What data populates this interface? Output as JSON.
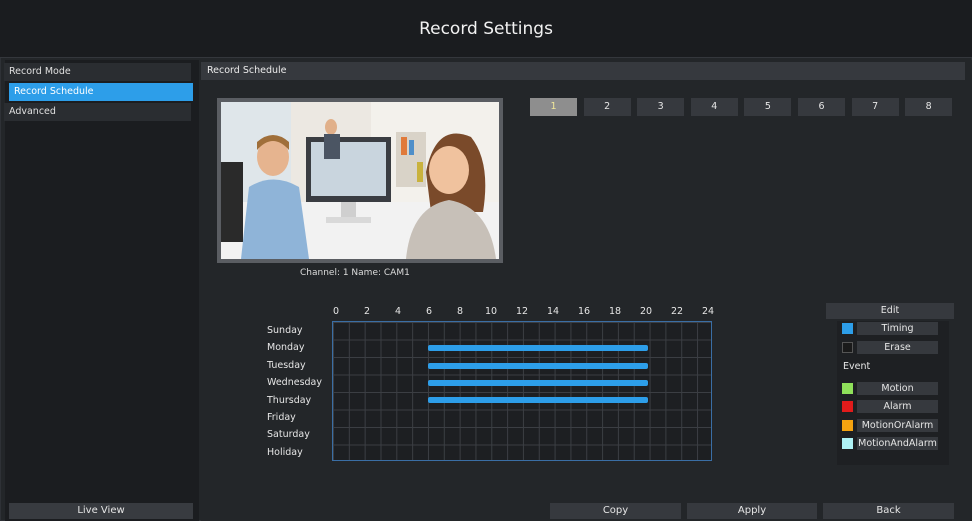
{
  "title": "Record Settings",
  "sidebar": {
    "items": [
      {
        "label": "Record Mode"
      },
      {
        "label": "Record Schedule"
      },
      {
        "label": "Advanced"
      }
    ],
    "live_view_label": "Live View"
  },
  "section_header": "Record Schedule",
  "preview": {
    "caption": "Channel: 1 Name: CAM1"
  },
  "channels": [
    "1",
    "2",
    "3",
    "4",
    "5",
    "6",
    "7",
    "8"
  ],
  "active_channel": "1",
  "schedule": {
    "hours": [
      "0",
      "2",
      "4",
      "6",
      "8",
      "10",
      "12",
      "14",
      "16",
      "18",
      "20",
      "22",
      "24"
    ],
    "days": [
      "Sunday",
      "Monday",
      "Tuesday",
      "Wednesday",
      "Thursday",
      "Friday",
      "Saturday",
      "Holiday"
    ],
    "timing_ranges": [
      {
        "day": "Monday",
        "start": 6,
        "end": 20
      },
      {
        "day": "Tuesday",
        "start": 6,
        "end": 20
      },
      {
        "day": "Wednesday",
        "start": 6,
        "end": 20
      },
      {
        "day": "Thursday",
        "start": 6,
        "end": 20
      }
    ]
  },
  "legend": {
    "edit_label": "Edit",
    "timing_label": "Timing",
    "erase_label": "Erase",
    "event_label": "Event",
    "motion_label": "Motion",
    "alarm_label": "Alarm",
    "motion_or_alarm_label": "MotionOrAlarm",
    "motion_and_alarm_label": "MotionAndAlarm",
    "colors": {
      "timing": "#2d9ee9",
      "erase": "#1a1a1a",
      "motion": "#8fe05a",
      "alarm": "#e11b1b",
      "motion_or_alarm": "#f5a310",
      "motion_and_alarm": "#aef2f5"
    }
  },
  "footer": {
    "copy_label": "Copy",
    "apply_label": "Apply",
    "back_label": "Back"
  }
}
